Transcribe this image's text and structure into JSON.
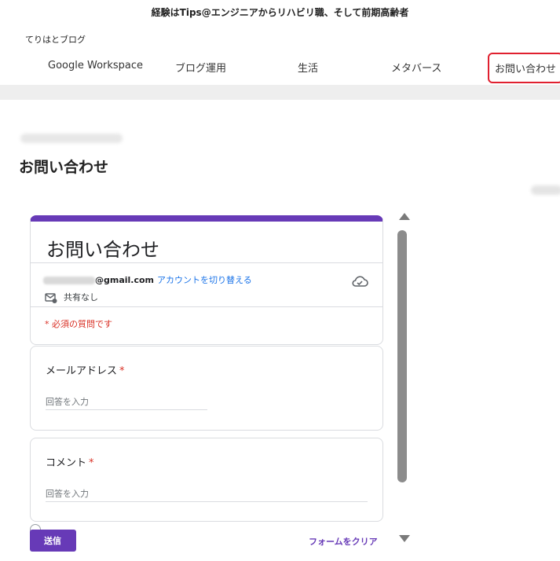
{
  "site": {
    "tagline": "経験はTips@エンジニアからリハビリ職、そして前期高齢者",
    "name": "てりはとブログ"
  },
  "nav": {
    "items": [
      "Google Workspace",
      "ブログ運用",
      "生活",
      "メタバース",
      "お問い合わせ"
    ],
    "active": "お問い合わせ",
    "active_outline_color": "#e0202f"
  },
  "page": {
    "title": "お問い合わせ"
  },
  "form": {
    "title": "お問い合わせ",
    "accent_color": "#673ab7",
    "account": {
      "email_domain": "@gmail.com",
      "switch_link": "アカウントを切り替える",
      "share_status": "共有なし"
    },
    "required_note": "* 必須の質問です",
    "questions": [
      {
        "label": "メールアドレス",
        "required_mark": "*",
        "placeholder": "回答を入力"
      },
      {
        "label": "コメント",
        "required_mark": "*",
        "placeholder": "回答を入力"
      }
    ],
    "submit_label": "送信",
    "clear_label": "フォームをクリア"
  },
  "icons": {
    "cloud": "cloud-check-icon",
    "share": "mail-share-icon",
    "scroll_up": "triangle-up-icon",
    "scroll_down": "triangle-down-icon"
  }
}
